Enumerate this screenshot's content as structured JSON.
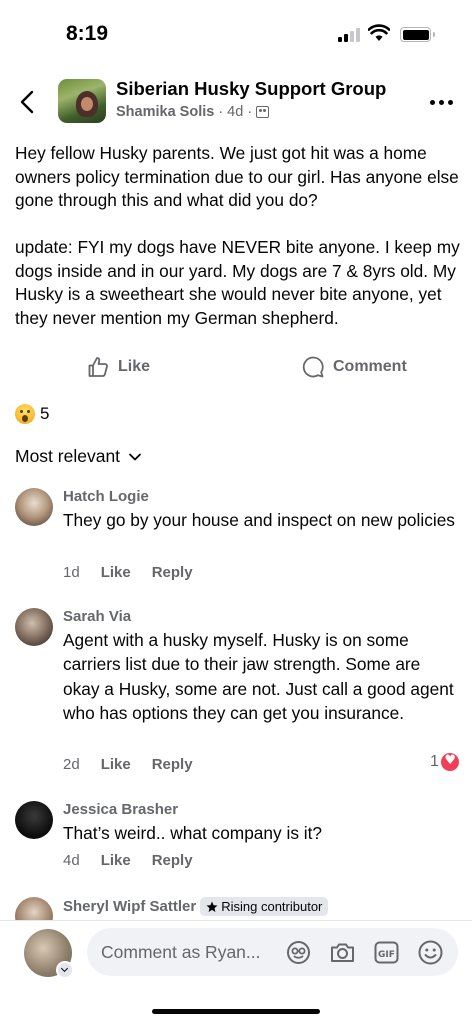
{
  "status_bar": {
    "time": "8:19"
  },
  "header": {
    "group_name": "Siberian Husky Support Group",
    "author": "Shamika Solis",
    "time": "4d",
    "separator": "·"
  },
  "post": {
    "paragraphs": [
      "Hey fellow Husky parents. We just got hit was a home owners policy termination due to our girl. Has anyone else gone through this and what did you do?",
      "update: FYI my dogs have NEVER bite anyone. I keep my dogs inside and in our yard. My dogs are 7 & 8yrs old. My Husky is a sweetheart she would never bite anyone, yet they never mention my German shepherd."
    ]
  },
  "actions": {
    "like_label": "Like",
    "comment_label": "Comment"
  },
  "reactions": {
    "count": "5"
  },
  "sort": {
    "label": "Most relevant"
  },
  "comments": [
    {
      "name": "Hatch Logie",
      "text": "They go by your house and inspect on new policies",
      "time": "1d",
      "like": "Like",
      "reply": "Reply"
    },
    {
      "name": "Sarah Via",
      "text": "Agent with a husky myself. Husky is on some carriers list due to their jaw strength. Some are okay a Husky, some are not. Just call a good agent who has options they can get you insurance.",
      "time": "2d",
      "like": "Like",
      "reply": "Reply",
      "reaction_count": "1"
    },
    {
      "name": "Jessica Brasher",
      "text": "That’s weird.. what company is it?",
      "time": "4d",
      "like": "Like",
      "reply": "Reply"
    },
    {
      "name": "Sheryl Wipf Sattler",
      "badge": "Rising contributor"
    }
  ],
  "composer": {
    "placeholder": "Comment as Ryan..."
  },
  "icons": {
    "back": "chevron-left-icon",
    "more": "more-dots-icon",
    "like": "thumbs-up-icon",
    "comment": "comment-bubble-icon",
    "wow": "wow-reaction-icon",
    "love": "love-reaction-icon",
    "avatar_frame": "avatar-frame-icon",
    "camera": "camera-icon",
    "gif": "gif-icon",
    "emoji": "emoji-icon"
  },
  "colors": {
    "secondary_text": "#65676b",
    "love": "#f33e58",
    "input_bg": "#f0f2f5"
  }
}
